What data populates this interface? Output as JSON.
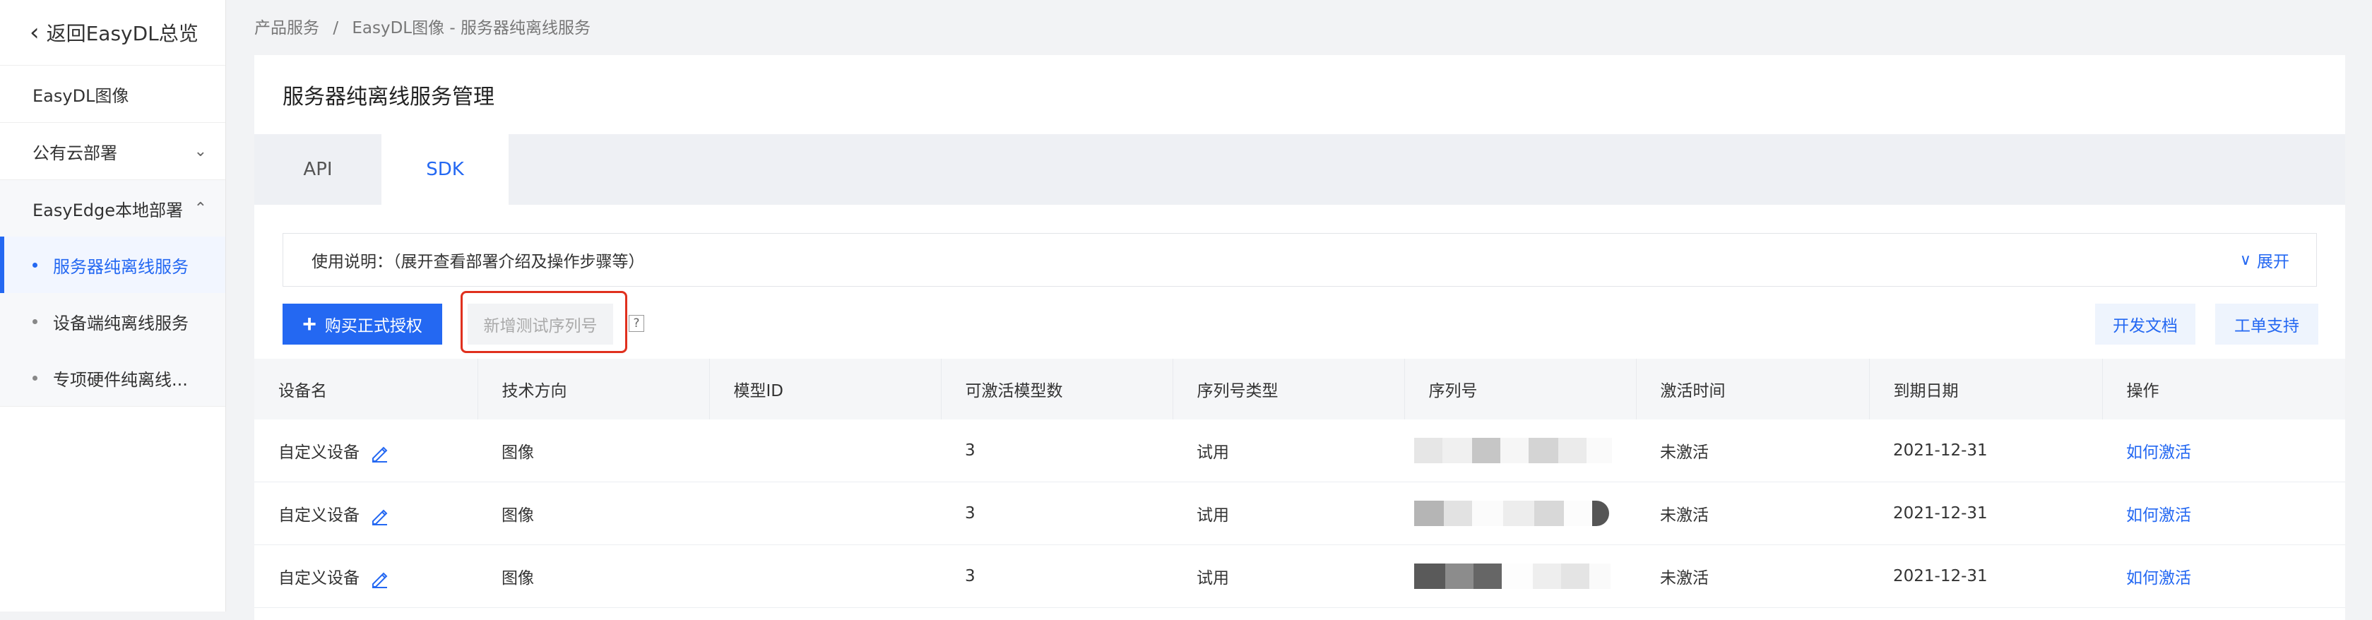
{
  "sidebar": {
    "back_label": "返回EasyDL总览",
    "items": [
      {
        "label": "EasyDL图像"
      },
      {
        "label": "公有云部署"
      },
      {
        "label": "EasyEdge本地部署"
      }
    ],
    "subitems": [
      {
        "label": "服务器纯离线服务"
      },
      {
        "label": "设备端纯离线服务"
      },
      {
        "label": "专项硬件纯离线..."
      }
    ]
  },
  "breadcrumb": {
    "root": "产品服务",
    "separator": "/",
    "current": "EasyDL图像 - 服务器纯离线服务"
  },
  "page": {
    "title": "服务器纯离线服务管理"
  },
  "tabs": [
    {
      "label": "API"
    },
    {
      "label": "SDK"
    }
  ],
  "usage": {
    "text": "使用说明：（展开查看部署介绍及操作步骤等）",
    "expand_label": "展开"
  },
  "toolbar": {
    "buy_label": "购买正式授权",
    "add_test_label": "新增测试序列号",
    "help_mark": "?",
    "dev_doc_label": "开发文档",
    "ticket_label": "工单支持"
  },
  "table": {
    "headers": [
      "设备名",
      "技术方向",
      "模型ID",
      "可激活模型数",
      "序列号类型",
      "序列号",
      "激活时间",
      "到期日期",
      "操作"
    ],
    "rows": [
      {
        "device": "自定义设备",
        "direction": "图像",
        "model_id": "",
        "count": "3",
        "type": "试用",
        "activation": "未激活",
        "expiry": "2021-12-31",
        "action": "如何激活"
      },
      {
        "device": "自定义设备",
        "direction": "图像",
        "model_id": "",
        "count": "3",
        "type": "试用",
        "activation": "未激活",
        "expiry": "2021-12-31",
        "action": "如何激活"
      },
      {
        "device": "自定义设备",
        "direction": "图像",
        "model_id": "",
        "count": "3",
        "type": "试用",
        "activation": "未激活",
        "expiry": "2021-12-31",
        "action": "如何激活"
      }
    ]
  },
  "colors": {
    "accent": "#2468f2",
    "highlight": "#e0301e"
  }
}
